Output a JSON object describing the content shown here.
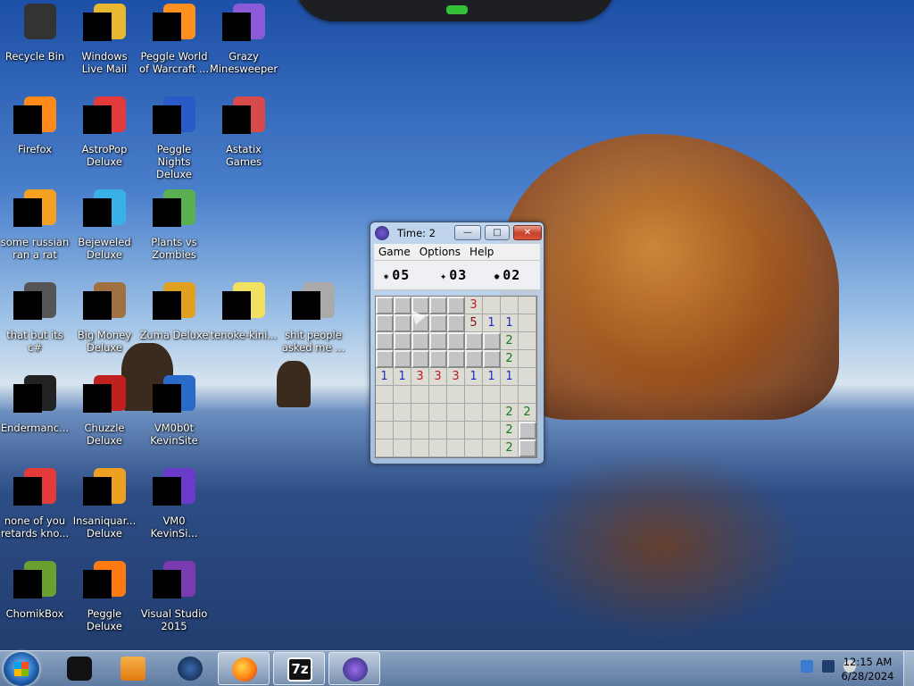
{
  "desktop": {
    "icons": [
      {
        "label": "Recycle Bin",
        "icon": "recycle-bin-icon"
      },
      {
        "label": "Windows Live Mail",
        "icon": "windows-live-mail-icon"
      },
      {
        "label": "Peggle World of Warcraft ...",
        "icon": "peggle-wow-icon"
      },
      {
        "label": "Grazy Minesweeper",
        "icon": "minesweeper-icon"
      },
      {
        "label": "Firefox",
        "icon": "firefox-icon"
      },
      {
        "label": "AstroPop Deluxe",
        "icon": "astropop-icon"
      },
      {
        "label": "Peggle Nights Deluxe",
        "icon": "peggle-nights-icon"
      },
      {
        "label": "Astatix Games",
        "icon": "astatix-icon"
      },
      {
        "label": "some russian ran a rat",
        "icon": "file-icon"
      },
      {
        "label": "Bejeweled Deluxe",
        "icon": "bejeweled-icon"
      },
      {
        "label": "Plants vs Zombies",
        "icon": "plants-vs-zombies-icon"
      },
      {
        "label": "that but its c#",
        "icon": "file-icon"
      },
      {
        "label": "Big Money Deluxe",
        "icon": "big-money-icon"
      },
      {
        "label": "Zuma Deluxe",
        "icon": "zuma-icon"
      },
      {
        "label": "tenoke-kini...",
        "icon": "iso-file-icon"
      },
      {
        "label": "shit people asked me ...",
        "icon": "folder-icon"
      },
      {
        "label": "Endermanc...",
        "icon": "app-icon"
      },
      {
        "label": "Chuzzle Deluxe",
        "icon": "chuzzle-icon"
      },
      {
        "label": "VM0b0t KevinSite",
        "icon": "vm-icon"
      },
      {
        "label": "none of you retards kno...",
        "icon": "app-icon"
      },
      {
        "label": "Insaniquar... Deluxe",
        "icon": "insaniquarium-icon"
      },
      {
        "label": "VM0 KevinSi...",
        "icon": "vm-icon"
      },
      {
        "label": "ChomikBox",
        "icon": "chomikbox-icon"
      },
      {
        "label": "Peggle Deluxe",
        "icon": "peggle-icon"
      },
      {
        "label": "Visual Studio 2015",
        "icon": "visual-studio-icon"
      }
    ]
  },
  "minesweeper": {
    "title": "Time: 2",
    "menu": [
      "Game",
      "Options",
      "Help"
    ],
    "counter_a": "05",
    "counter_b": "03",
    "counter_c": "02",
    "grid": [
      [
        "c",
        "c",
        "c",
        "c",
        "c",
        "3",
        "o",
        "o",
        "o"
      ],
      [
        "c",
        "c",
        "c",
        "c",
        "c",
        "5",
        "1",
        "1",
        "o"
      ],
      [
        "c",
        "c",
        "c",
        "c",
        "c",
        "c",
        "c",
        "2",
        "o"
      ],
      [
        "c",
        "c",
        "c",
        "c",
        "c",
        "c",
        "c",
        "2",
        "o"
      ],
      [
        "1",
        "1",
        "3",
        "3",
        "3",
        "1",
        "1",
        "1",
        "o"
      ],
      [
        "o",
        "o",
        "o",
        "o",
        "o",
        "o",
        "o",
        "o",
        "o"
      ],
      [
        "o",
        "o",
        "o",
        "o",
        "o",
        "o",
        "o",
        "2",
        "2"
      ],
      [
        "o",
        "o",
        "o",
        "o",
        "o",
        "o",
        "o",
        "2",
        "c"
      ],
      [
        "o",
        "o",
        "o",
        "o",
        "o",
        "o",
        "o",
        "2",
        "c"
      ]
    ]
  },
  "taskbar": {
    "buttons": [
      "explorer",
      "media-player",
      "network",
      "firefox",
      "7-zip",
      "minesweeper"
    ],
    "clock_time": "12:15 AM",
    "clock_date": "6/28/2024"
  }
}
